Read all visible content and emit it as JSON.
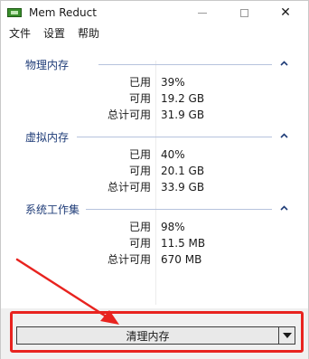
{
  "window": {
    "title": "Mem Reduct",
    "icon": "memory-chip-icon",
    "controls": {
      "minimize": "minimize-icon",
      "maximize": "maximize-icon",
      "close": "close-icon",
      "close_glyph": "✕"
    }
  },
  "menu": {
    "items": [
      {
        "label": "文件"
      },
      {
        "label": "设置"
      },
      {
        "label": "帮助"
      }
    ]
  },
  "groups": [
    {
      "title": "物理内存",
      "rows": [
        {
          "label": "已用",
          "value": "39%"
        },
        {
          "label": "可用",
          "value": "19.2 GB"
        },
        {
          "label": "总计可用",
          "value": "31.9 GB"
        }
      ]
    },
    {
      "title": "虚拟内存",
      "rows": [
        {
          "label": "已用",
          "value": "40%"
        },
        {
          "label": "可用",
          "value": "20.1 GB"
        },
        {
          "label": "总计可用",
          "value": "33.9 GB"
        }
      ]
    },
    {
      "title": "系统工作集",
      "rows": [
        {
          "label": "已用",
          "value": "98%"
        },
        {
          "label": "可用",
          "value": "11.5 MB"
        },
        {
          "label": "总计可用",
          "value": "670 MB"
        }
      ]
    }
  ],
  "action": {
    "clean_label": "清理内存",
    "dropdown_icon": "caret-down-icon"
  },
  "colors": {
    "group_title": "#1f3c78",
    "annotation": "#e8231f"
  }
}
